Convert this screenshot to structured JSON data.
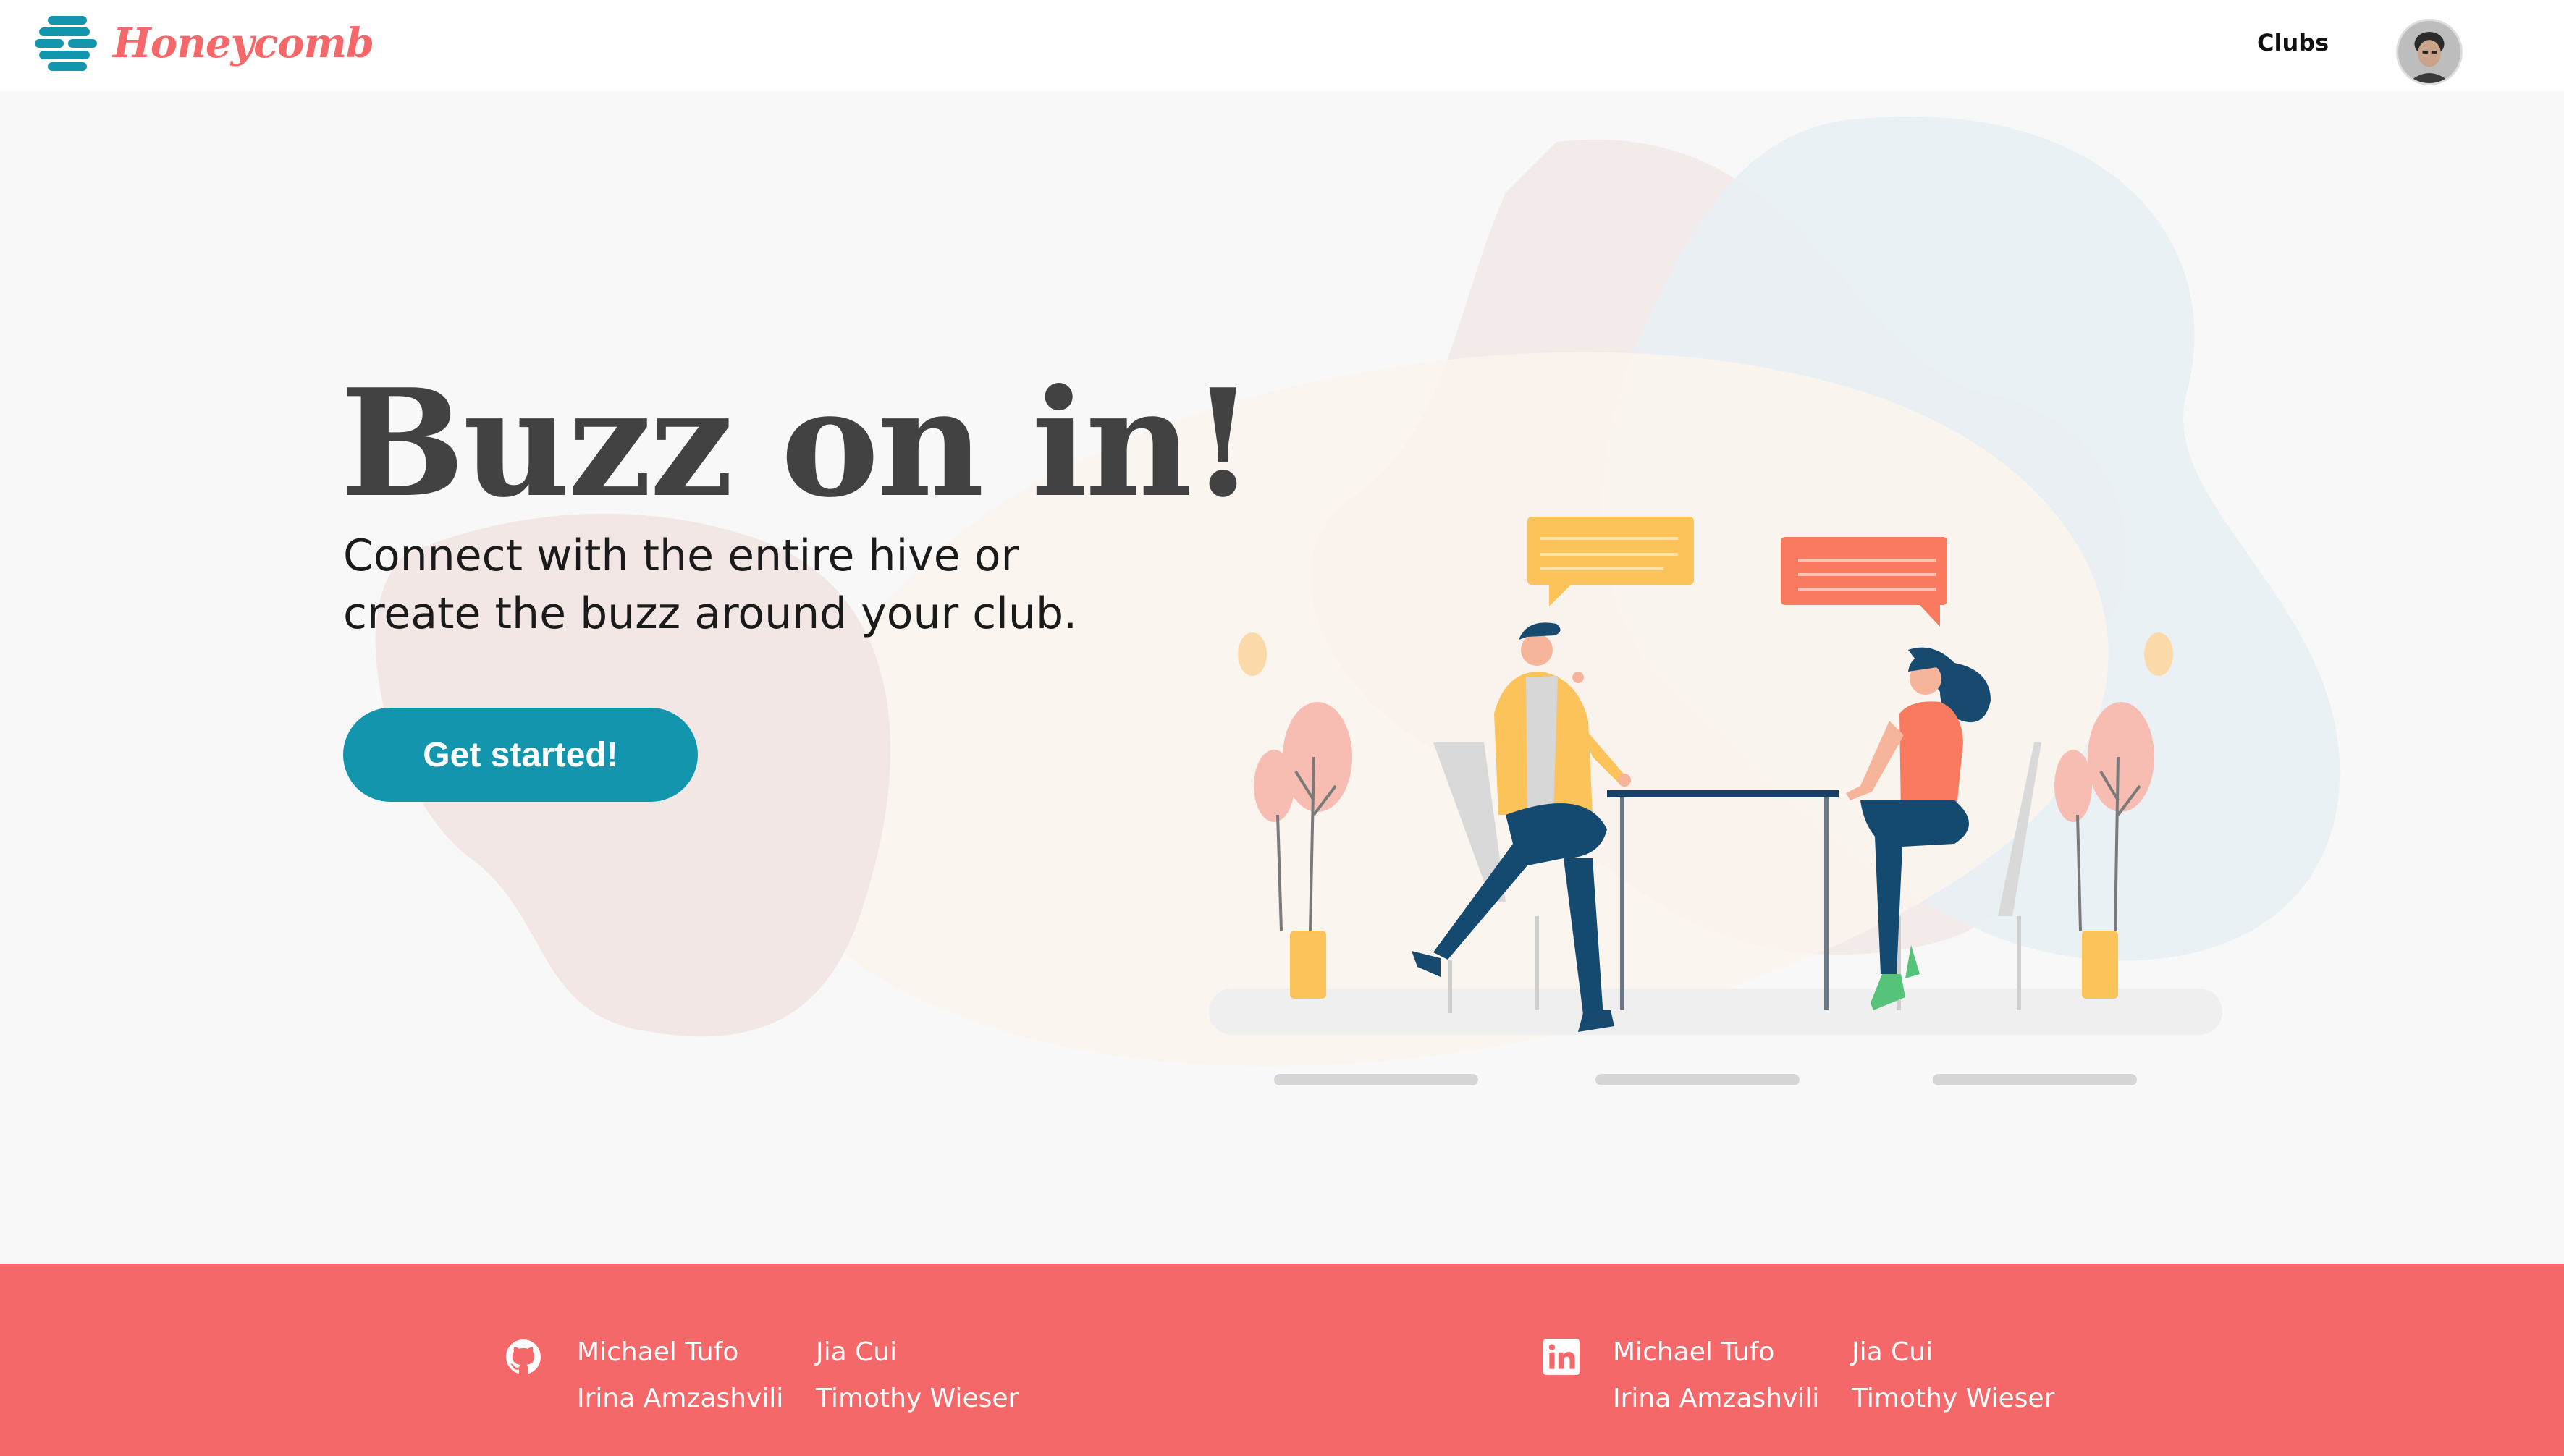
{
  "brand": {
    "name": "Honeycomb",
    "logo_icon": "honeycomb-stack-icon",
    "accent_color": "#f5686a",
    "primary_color": "#1396ad"
  },
  "nav": {
    "clubs_label": "Clubs",
    "avatar_icon": "user-avatar"
  },
  "hero": {
    "title": "Buzz on in!",
    "subtitle": "Connect with the entire hive or create the buzz around your club.",
    "cta_label": "Get started!"
  },
  "footer": {
    "background_color": "#f5686a",
    "github": {
      "icon": "github-icon",
      "names": [
        "Michael Tufo",
        "Jia Cui",
        "Irina Amzashvili",
        "Timothy Wieser"
      ]
    },
    "linkedin": {
      "icon": "linkedin-icon",
      "names": [
        "Michael Tufo",
        "Jia Cui",
        "Irina Amzashvili",
        "Timothy Wieser"
      ]
    }
  }
}
